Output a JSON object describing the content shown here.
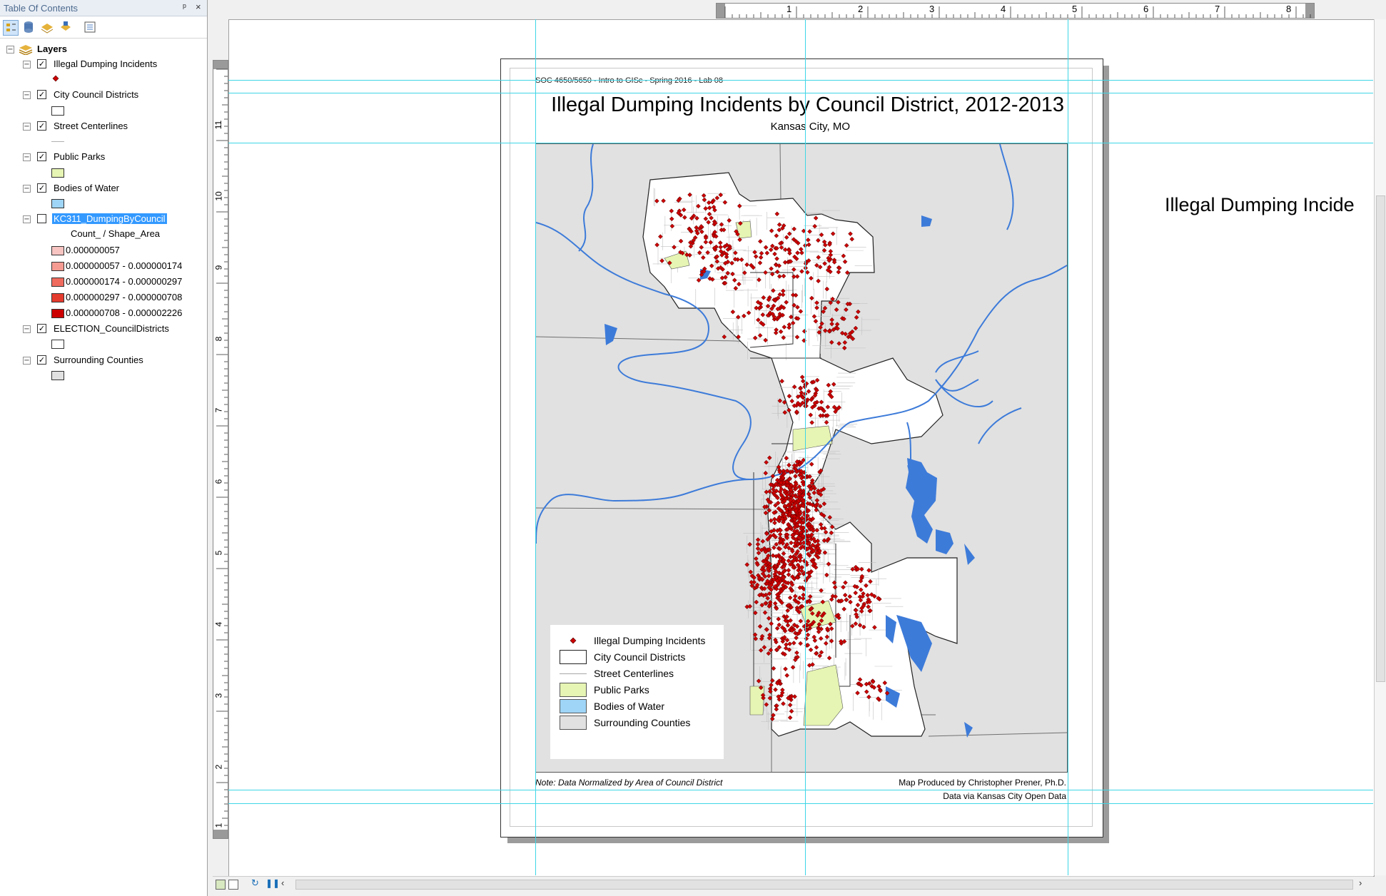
{
  "toc": {
    "title": "Table Of Contents",
    "pin_glyph": "ᵖ",
    "close_glyph": "×",
    "root_label": "Layers",
    "layers": [
      {
        "name": "Illegal Dumping Incidents",
        "checked": true
      },
      {
        "name": "City Council Districts",
        "checked": true
      },
      {
        "name": "Street Centerlines",
        "checked": true
      },
      {
        "name": "Public Parks",
        "checked": true
      },
      {
        "name": "Bodies of Water",
        "checked": true
      },
      {
        "name": "KC311_DumpingByCouncil",
        "checked": false,
        "selected": true
      },
      {
        "name": "ELECTION_CouncilDistricts",
        "checked": true
      },
      {
        "name": "Surrounding Counties",
        "checked": true
      }
    ],
    "classification_field": "Count_ / Shape_Area",
    "classes": [
      {
        "label": "0.000000057",
        "color": "#f7c4c1"
      },
      {
        "label": "0.000000057 - 0.000000174",
        "color": "#f59b92"
      },
      {
        "label": "0.000000174 - 0.000000297",
        "color": "#ef6b5e"
      },
      {
        "label": "0.000000297 - 0.000000708",
        "color": "#e43b2f"
      },
      {
        "label": "0.000000708 - 0.000002226",
        "color": "#cc0000"
      }
    ],
    "check_glyph": "✓",
    "collapse_glyph": "−"
  },
  "rulers": {
    "horizontal": [
      "1",
      "2",
      "3",
      "4",
      "5",
      "6",
      "7",
      "8"
    ],
    "vertical": [
      "11",
      "10",
      "9",
      "8",
      "7",
      "6",
      "5",
      "4",
      "3",
      "2",
      "1"
    ]
  },
  "map": {
    "course_line": "SOC 4650/5650 - Intro to GISc - Spring 2016 - Lab 08",
    "title": "Illegal Dumping Incidents by Council District, 2012-2013",
    "subtitle": "Kansas City, MO",
    "note": "Note: Data Normalized by Area of Council District",
    "credit_line1": "Map Produced by Christopher Prener, Ph.D.",
    "credit_line2": "Data via Kansas City Open Data",
    "legend": [
      {
        "label": "Illegal Dumping Incidents",
        "type": "point",
        "color": "#cc0000"
      },
      {
        "label": "City Council Districts",
        "type": "box",
        "color": "#ffffff"
      },
      {
        "label": "Street Centerlines",
        "type": "line",
        "color": "#b0b0b0"
      },
      {
        "label": "Public Parks",
        "type": "box",
        "color": "#e6f5b3"
      },
      {
        "label": "Bodies of Water",
        "type": "box",
        "color": "#9fd5f7"
      },
      {
        "label": "Surrounding Counties",
        "type": "box",
        "color": "#e1e1e1"
      }
    ]
  },
  "offpage_text": "Illegal Dumping Incide",
  "colors": {
    "selection": "#3399ff",
    "guide": "#3ed6e6",
    "water": "#3d7bd9",
    "incident": "#cc0000"
  }
}
